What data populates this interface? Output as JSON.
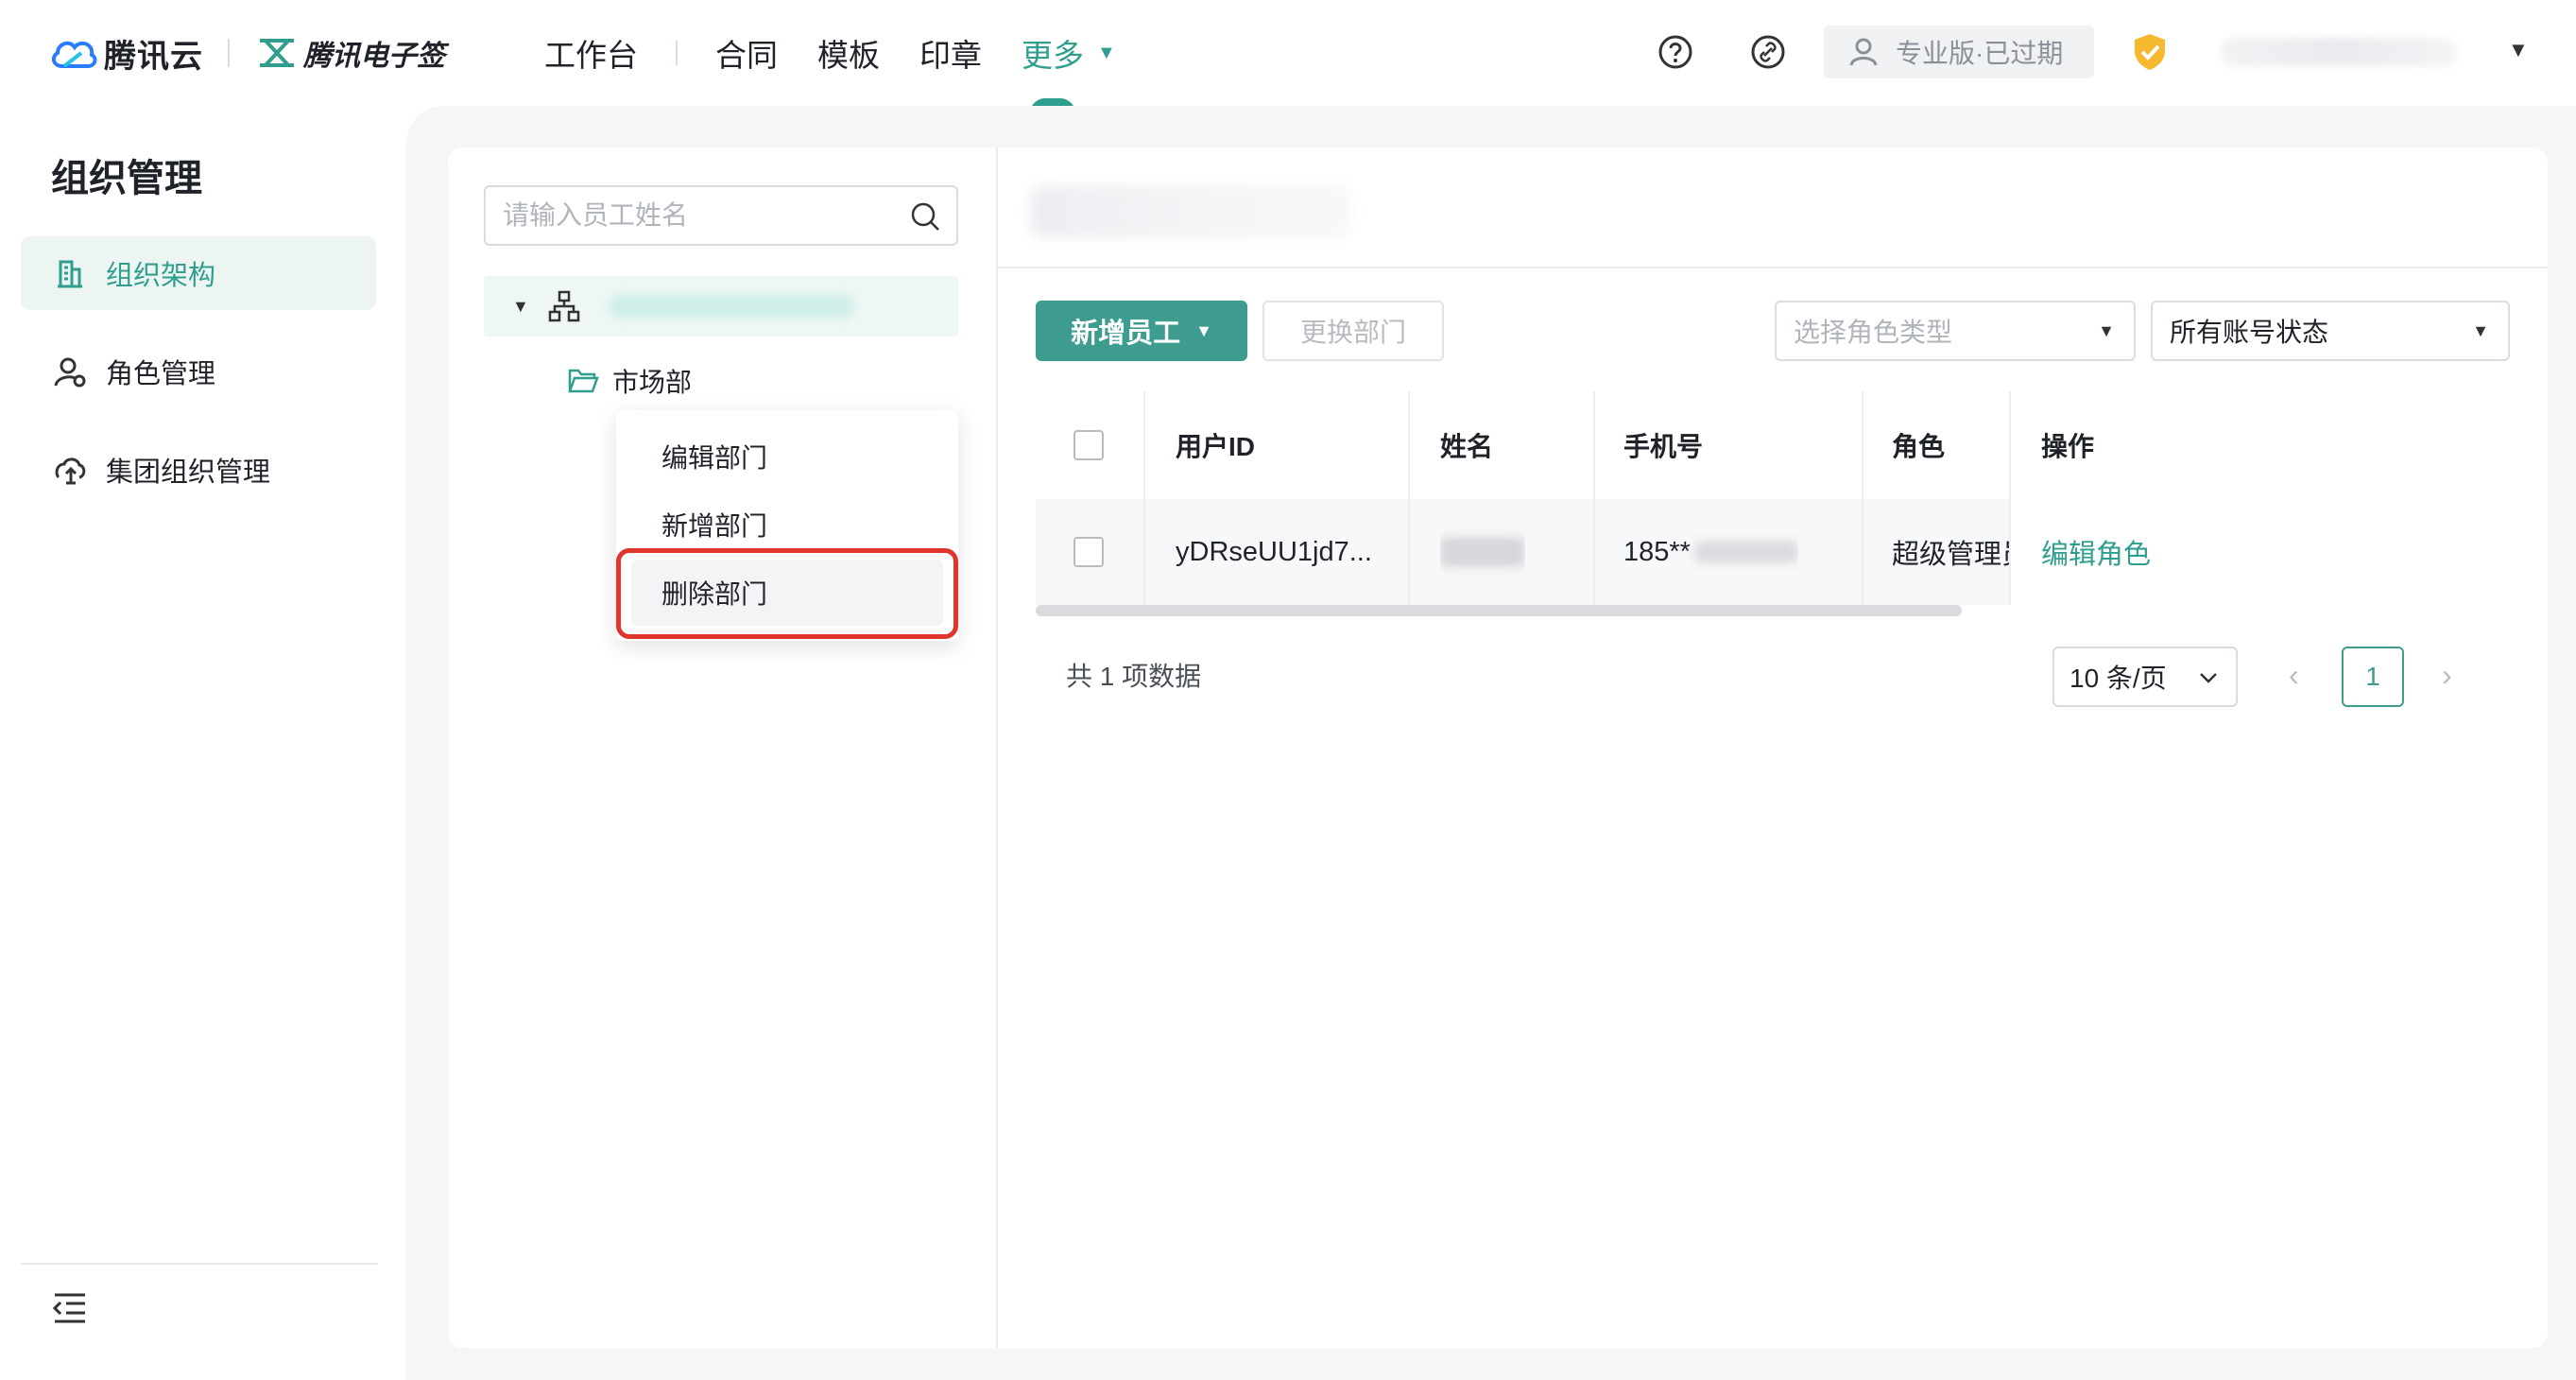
{
  "header": {
    "brand": "腾讯云",
    "product": "腾讯电子签",
    "nav": [
      "工作台",
      "合同",
      "模板",
      "印章",
      "更多"
    ],
    "plan_label": "专业版·已过期",
    "colors": {
      "accent": "#2f9e8f",
      "primary_button": "#3d9c8e",
      "highlight": "#e0352b"
    }
  },
  "sidebar": {
    "title": "组织管理",
    "items": [
      {
        "label": "组织架构",
        "icon": "org-chart-icon",
        "active": true
      },
      {
        "label": "角色管理",
        "icon": "user-role-icon",
        "active": false
      },
      {
        "label": "集团组织管理",
        "icon": "group-org-icon",
        "active": false
      }
    ]
  },
  "tree": {
    "search_placeholder": "请输入员工姓名",
    "child_node": "市场部",
    "context_menu": [
      "编辑部门",
      "新增部门",
      "删除部门"
    ]
  },
  "toolbar": {
    "add_employee": "新增员工",
    "change_dept": "更换部门",
    "role_placeholder": "选择角色类型",
    "status_value": "所有账号状态"
  },
  "table": {
    "columns": [
      "用户ID",
      "姓名",
      "手机号",
      "角色",
      "操作"
    ],
    "rows": [
      {
        "user_id": "yDRseUU1jd7...",
        "phone": "185**",
        "role": "超级管理员",
        "action": "编辑角色"
      }
    ]
  },
  "pagination": {
    "total": "共 1 项数据",
    "page_size": "10 条/页",
    "current_page": "1"
  }
}
